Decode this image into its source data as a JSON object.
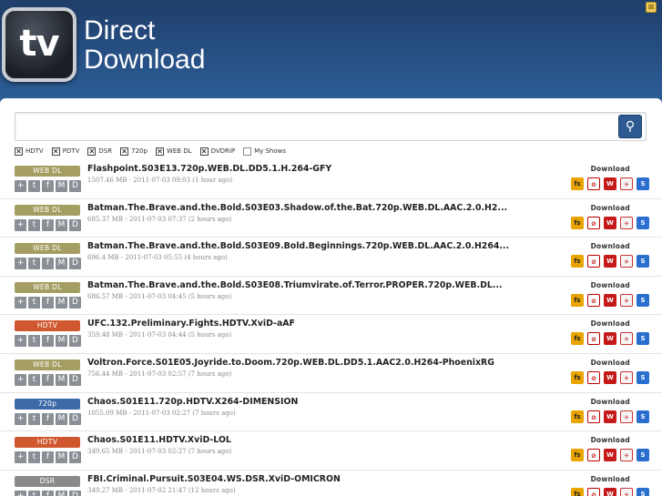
{
  "header": {
    "logo_text": "tv",
    "brand_line1": "Direct",
    "brand_line2": "Download"
  },
  "search": {
    "value": "",
    "button_icon": "search-icon"
  },
  "filters": [
    {
      "label": "HDTV",
      "checked": true
    },
    {
      "label": "PDTV",
      "checked": true
    },
    {
      "label": "DSR",
      "checked": true
    },
    {
      "label": "720p",
      "checked": true
    },
    {
      "label": "WEB DL",
      "checked": true
    },
    {
      "label": "DVDRiP",
      "checked": true
    },
    {
      "label": "My Shows",
      "checked": false
    }
  ],
  "colors": {
    "WEB DL": "#a49e62",
    "HDTV": "#d0582f",
    "720p": "#3f6aa8",
    "DSR": "#8a8a8a"
  },
  "download_label": "Download",
  "host_icons": [
    "fs",
    "ul",
    "W",
    "ht",
    "ff"
  ],
  "releases": [
    {
      "tag": "WEB DL",
      "title": "Flashpoint.S03E13.720p.WEB.DL.DD5.1.H.264-GFY",
      "meta": "1507.46 MB - 2011-07-03 09:03 (1 hour ago)"
    },
    {
      "tag": "WEB DL",
      "title": "Batman.The.Brave.and.the.Bold.S03E03.Shadow.of.the.Bat.720p.WEB.DL.AAC.2.0.H2...",
      "meta": "685.37 MB - 2011-07-03 07:37 (2 hours ago)"
    },
    {
      "tag": "WEB DL",
      "title": "Batman.The.Brave.and.the.Bold.S03E09.Bold.Beginnings.720p.WEB.DL.AAC.2.0.H264...",
      "meta": "696.4 MB - 2011-07-03 05:55 (4 hours ago)"
    },
    {
      "tag": "WEB DL",
      "title": "Batman.The.Brave.and.the.Bold.S03E08.Triumvirate.of.Terror.PROPER.720p.WEB.DL...",
      "meta": "686.57 MB - 2011-07-03 04:45 (5 hours ago)"
    },
    {
      "tag": "HDTV",
      "title": "UFC.132.Preliminary.Fights.HDTV.XviD-aAF",
      "meta": "359.48 MB - 2011-07-03 04:44 (5 hours ago)"
    },
    {
      "tag": "WEB DL",
      "title": "Voltron.Force.S01E05.Joyride.to.Doom.720p.WEB.DL.DD5.1.AAC2.0.H264-PhoenixRG",
      "meta": "756.44 MB - 2011-07-03 02:57 (7 hours ago)"
    },
    {
      "tag": "720p",
      "title": "Chaos.S01E11.720p.HDTV.X264-DIMENSION",
      "meta": "1055.09 MB - 2011-07-03 02:27 (7 hours ago)"
    },
    {
      "tag": "HDTV",
      "title": "Chaos.S01E11.HDTV.XviD-LOL",
      "meta": "349.65 MB - 2011-07-03 02:27 (7 hours ago)"
    },
    {
      "tag": "DSR",
      "title": "FBI.Criminal.Pursuit.S03E04.WS.DSR.XviD-OMICRON",
      "meta": "349.27 MB - 2011-07-02 21:47 (12 hours ago)"
    }
  ]
}
